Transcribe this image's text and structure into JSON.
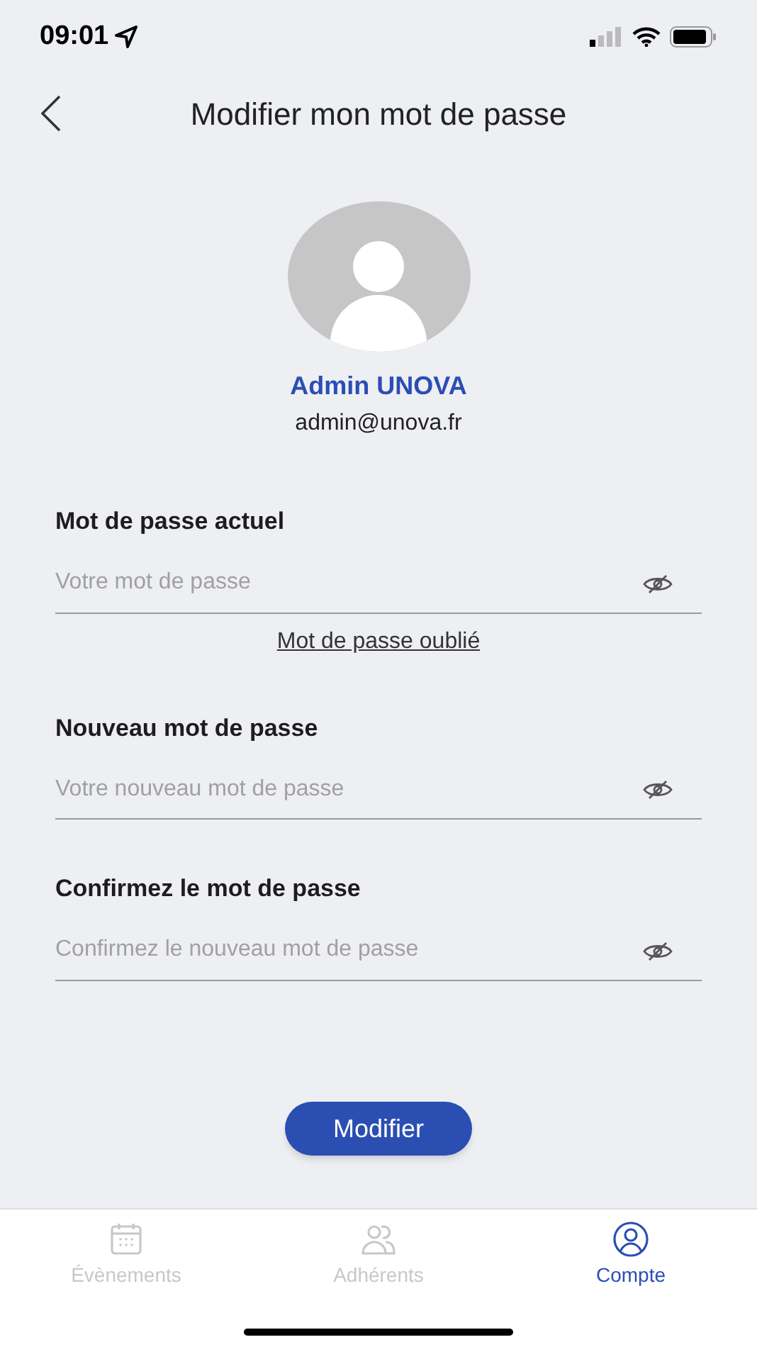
{
  "status_bar": {
    "time": "09:01"
  },
  "header": {
    "title": "Modifier mon mot de passe"
  },
  "profile": {
    "name": "Admin UNOVA",
    "email": "admin@unova.fr"
  },
  "fields": [
    {
      "label": "Mot de passe actuel",
      "placeholder": "Votre mot de passe",
      "link": "Mot de passe oublié"
    },
    {
      "label": "Nouveau mot de passe",
      "placeholder": "Votre nouveau mot de passe"
    },
    {
      "label": "Confirmez le mot de passe",
      "placeholder": "Confirmez le nouveau mot de passe"
    }
  ],
  "submit": "Modifier",
  "tabs": [
    {
      "label": "Évènements",
      "kind": "calendar",
      "selected": false
    },
    {
      "label": "Adhérents",
      "kind": "people",
      "selected": false
    },
    {
      "label": "Compte",
      "kind": "account",
      "selected": true
    }
  ]
}
